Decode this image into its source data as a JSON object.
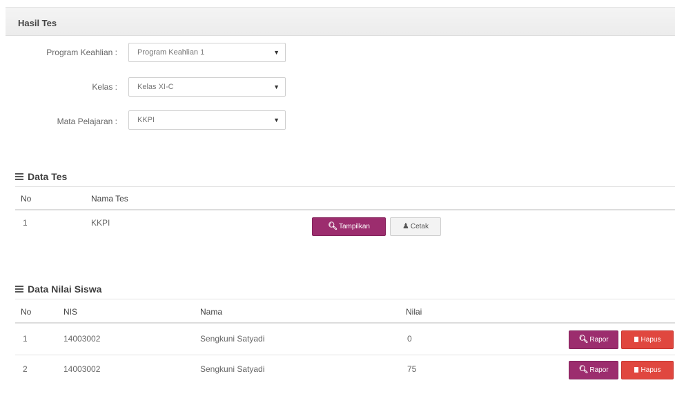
{
  "panel": {
    "title": "Hasil Tes"
  },
  "filters": {
    "program": {
      "label": "Program Keahlian :",
      "value": "Program Keahlian 1"
    },
    "kelas": {
      "label": "Kelas :",
      "value": "Kelas XI-C"
    },
    "mapel": {
      "label": "Mata Pelajaran :",
      "value": "KKPI"
    }
  },
  "data_tes": {
    "title": "Data Tes",
    "columns": [
      "No",
      "Nama Tes"
    ],
    "rows": [
      {
        "no": "1",
        "nama": "KKPI"
      }
    ],
    "buttons": {
      "tampilkan": "Tampilkan",
      "cetak": "Cetak"
    }
  },
  "data_nilai": {
    "title": "Data Nilai Siswa",
    "columns": [
      "No",
      "NIS",
      "Nama",
      "Nilai"
    ],
    "rows": [
      {
        "no": "1",
        "nis": "14003002",
        "nama": "Sengkuni Satyadi",
        "nilai": "0"
      },
      {
        "no": "2",
        "nis": "14003002",
        "nama": "Sengkuni Satyadi",
        "nilai": "75"
      }
    ],
    "buttons": {
      "rapor": "Rapor",
      "hapus": "Hapus"
    }
  },
  "colors": {
    "primary": "#9c2d6e",
    "danger": "#e0473f"
  }
}
